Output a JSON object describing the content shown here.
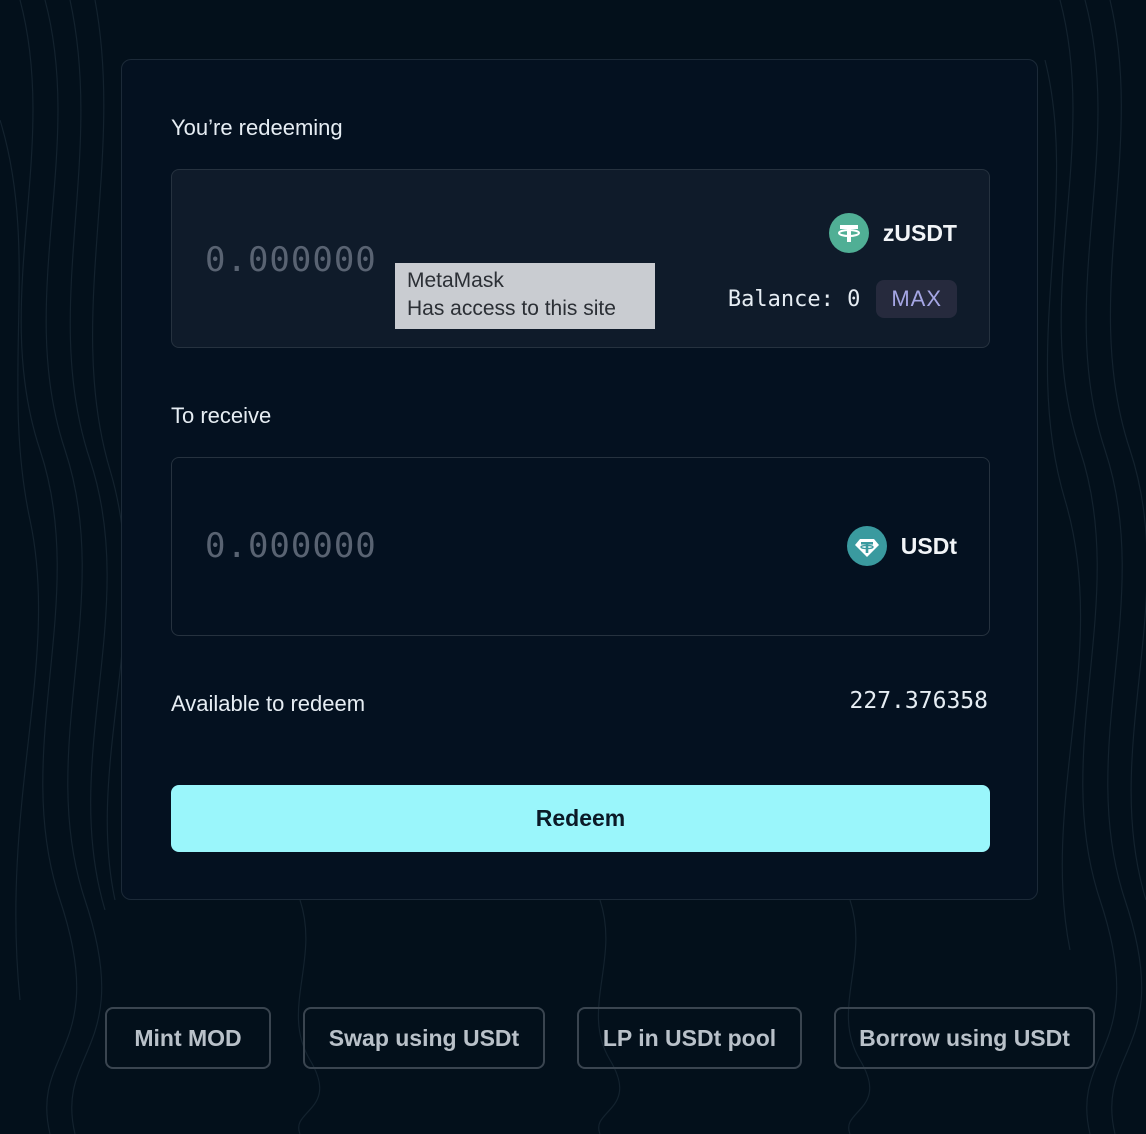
{
  "redeeming": {
    "label": "You’re redeeming",
    "amount_placeholder": "0.000000",
    "token": "zUSDT",
    "token_icon": "tether-coin-icon",
    "balance": "Balance: 0",
    "max_label": "MAX"
  },
  "tooltip": {
    "line1": "MetaMask",
    "line2": "Has access to this site"
  },
  "receiving": {
    "label": "To receive",
    "amount_placeholder": "0.000000",
    "token": "USDt",
    "token_icon": "tether-gem-icon"
  },
  "available": {
    "label": "Available to redeem",
    "value": "227.376358"
  },
  "redeem_button": "Redeem",
  "actions": [
    "Mint MOD",
    "Swap using USDt",
    "LP in USDt pool",
    "Borrow using USDt"
  ],
  "colors": {
    "background": "#03101b",
    "card": "#041120",
    "accent": "#9af6fb",
    "tether_green": "#50af95",
    "tether_teal": "#3a9a9f"
  }
}
